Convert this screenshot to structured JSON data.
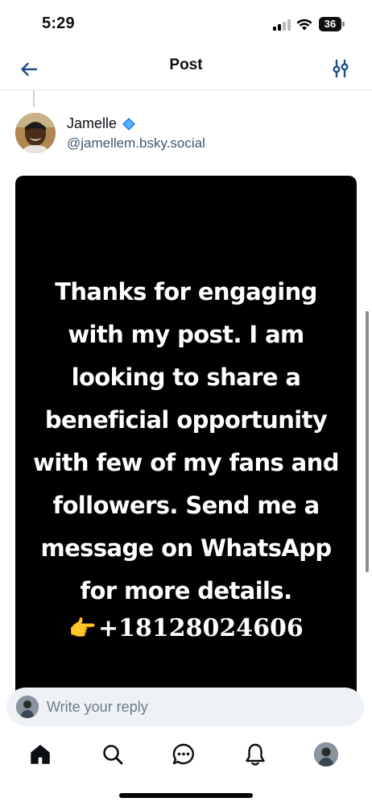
{
  "status_bar": {
    "time": "5:29",
    "battery": "36"
  },
  "header": {
    "title": "Post",
    "back_icon": "arrow-left-icon",
    "filter_icon": "sliders-icon"
  },
  "author": {
    "name": "Jamelle",
    "handle": "@jamellem.bsky.social",
    "verified_color": "#1d8bf0"
  },
  "post": {
    "image_text_lines": [
      "Thanks for engaging",
      "with my post. I am",
      "looking to share a",
      "beneficial opportunity",
      "with few of my fans and",
      "followers. Send me a",
      "message on WhatsApp",
      "for more details."
    ],
    "phone_emoji": "👉",
    "phone": "+18128024606"
  },
  "reply": {
    "placeholder": "Write your reply"
  },
  "bottom_nav": {
    "items": [
      "home-icon",
      "search-icon",
      "chat-icon",
      "bell-icon",
      "profile-avatar"
    ]
  },
  "colors": {
    "accent": "#1083fe",
    "muted_text": "#42576c",
    "reply_bg": "#eef1f5"
  }
}
